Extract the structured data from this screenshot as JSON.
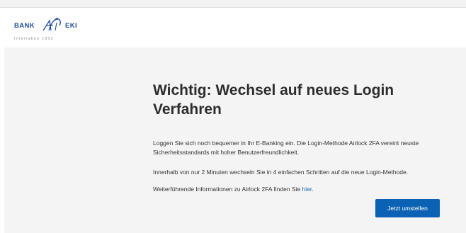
{
  "brand": {
    "word_left": "BANK",
    "word_right": "EKI",
    "subtitle": "Interlaken 1852",
    "color": "#1d4a9c"
  },
  "notice": {
    "title": "Wichtig: Wechsel auf neues Login Verfahren",
    "paragraph_1": "Loggen Sie sich noch bequemer in Ihr E-Banking ein. Die Login-Methode Airlock 2FA vereint neuste Sicherheitsstandards mit hoher Benutzerfreundlichkeit.",
    "paragraph_2": "Innerhalb von nur 2 Minuten wechseln Sie in 4 einfachen Schritten auf die neue Login-Methode.",
    "paragraph_3_prefix": "Weiterführende Informationen zu Airlock 2FA finden Sie ",
    "paragraph_3_link": "hier",
    "paragraph_3_suffix": "."
  },
  "actions": {
    "switch_button_label": "Jetzt umstellen",
    "button_color": "#0b61b3",
    "link_color": "#1a63b3"
  }
}
